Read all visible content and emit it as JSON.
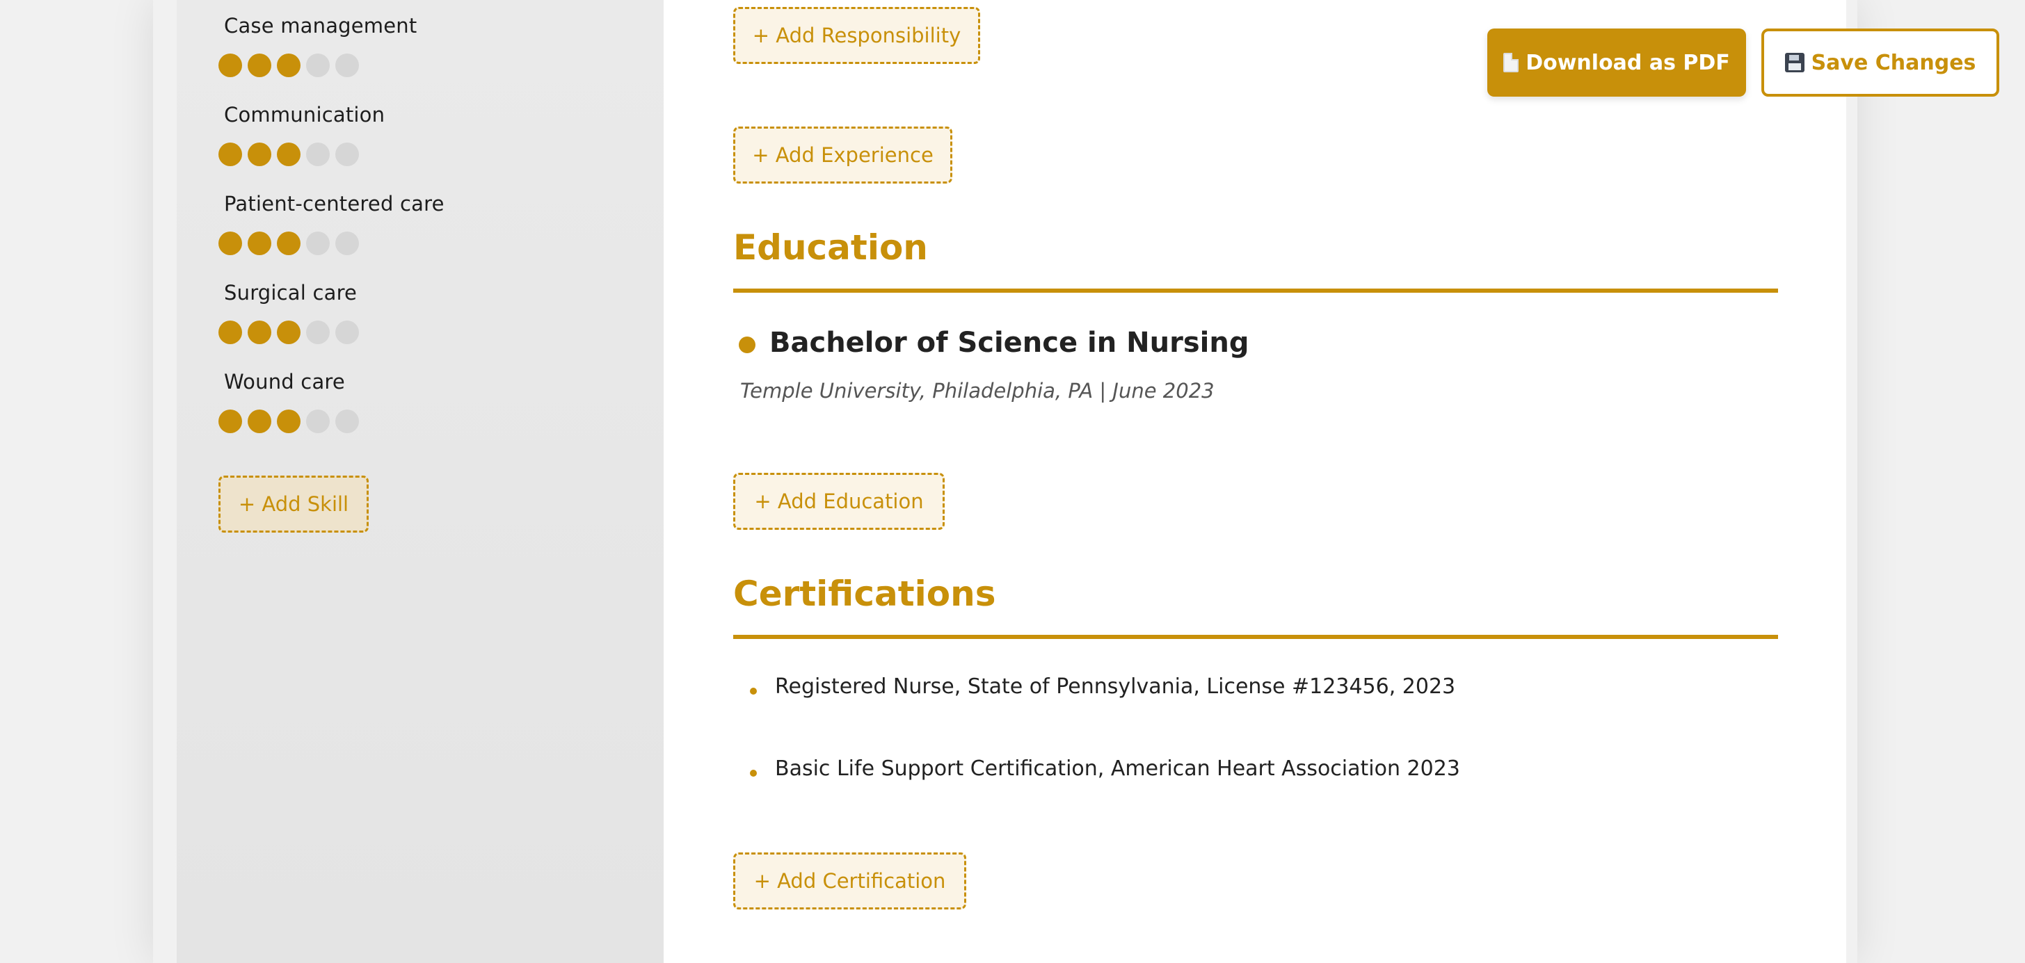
{
  "sidebar": {
    "skills": [
      {
        "name": "Case management",
        "level": 3,
        "max": 5
      },
      {
        "name": "Communication",
        "level": 3,
        "max": 5
      },
      {
        "name": "Patient-centered care",
        "level": 3,
        "max": 5
      },
      {
        "name": "Surgical care",
        "level": 3,
        "max": 5
      },
      {
        "name": "Wound care",
        "level": 3,
        "max": 5
      }
    ],
    "add_skill_label": "+ Add Skill"
  },
  "main": {
    "add_responsibility_label": "+ Add Responsibility",
    "add_experience_label": "+ Add Experience",
    "education": {
      "title": "Education",
      "degree": "Bachelor of Science in Nursing",
      "meta": "Temple University, Philadelphia, PA | June 2023",
      "add_label": "+ Add Education"
    },
    "certifications": {
      "title": "Certifications",
      "items": [
        "Registered Nurse, State of Pennsylvania, License #123456, 2023",
        "Basic Life Support Certification, American Heart Association 2023"
      ],
      "add_label": "+ Add Certification"
    }
  },
  "actions": {
    "download_label": "Download as PDF",
    "download_icon": "document-icon",
    "save_label": "Save Changes",
    "save_icon": "floppy-disk-icon"
  },
  "colors": {
    "accent": "#c8900a",
    "sidebar_bg": "#e8e8e8",
    "page_bg": "#f1f1f1"
  }
}
